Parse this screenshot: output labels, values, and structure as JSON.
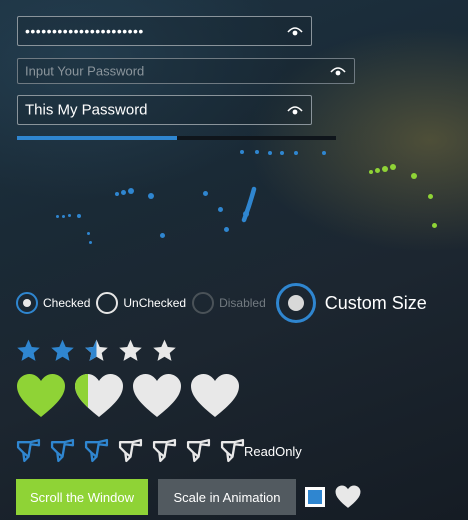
{
  "password_fields": {
    "field1": {
      "value": "••••••••••••••••••••••",
      "icon": "eye-icon"
    },
    "field2": {
      "placeholder": "Input Your Password",
      "value": "",
      "icon": "eye-icon"
    },
    "field3": {
      "value": "This My Password",
      "icon": "eye-icon"
    }
  },
  "strength_bar": {
    "fill_fraction": 0.5,
    "color": "#2f86d0"
  },
  "radios": {
    "checked": "Checked",
    "unchecked": "UnChecked",
    "disabled": "Disabled",
    "custom": "Custom Size"
  },
  "rating": {
    "stars_value": 2.5,
    "stars_max": 5,
    "hearts_value": 1.5,
    "hearts_max": 4
  },
  "readonly_rating": {
    "value": 3,
    "max": 7,
    "label": "ReadOnly"
  },
  "buttons": {
    "scroll": "Scroll the Window",
    "scale": "Scale in Animation"
  },
  "colors": {
    "accent": "#2f86d0",
    "green": "#8fd336",
    "inactive": "#e0e0e0"
  }
}
